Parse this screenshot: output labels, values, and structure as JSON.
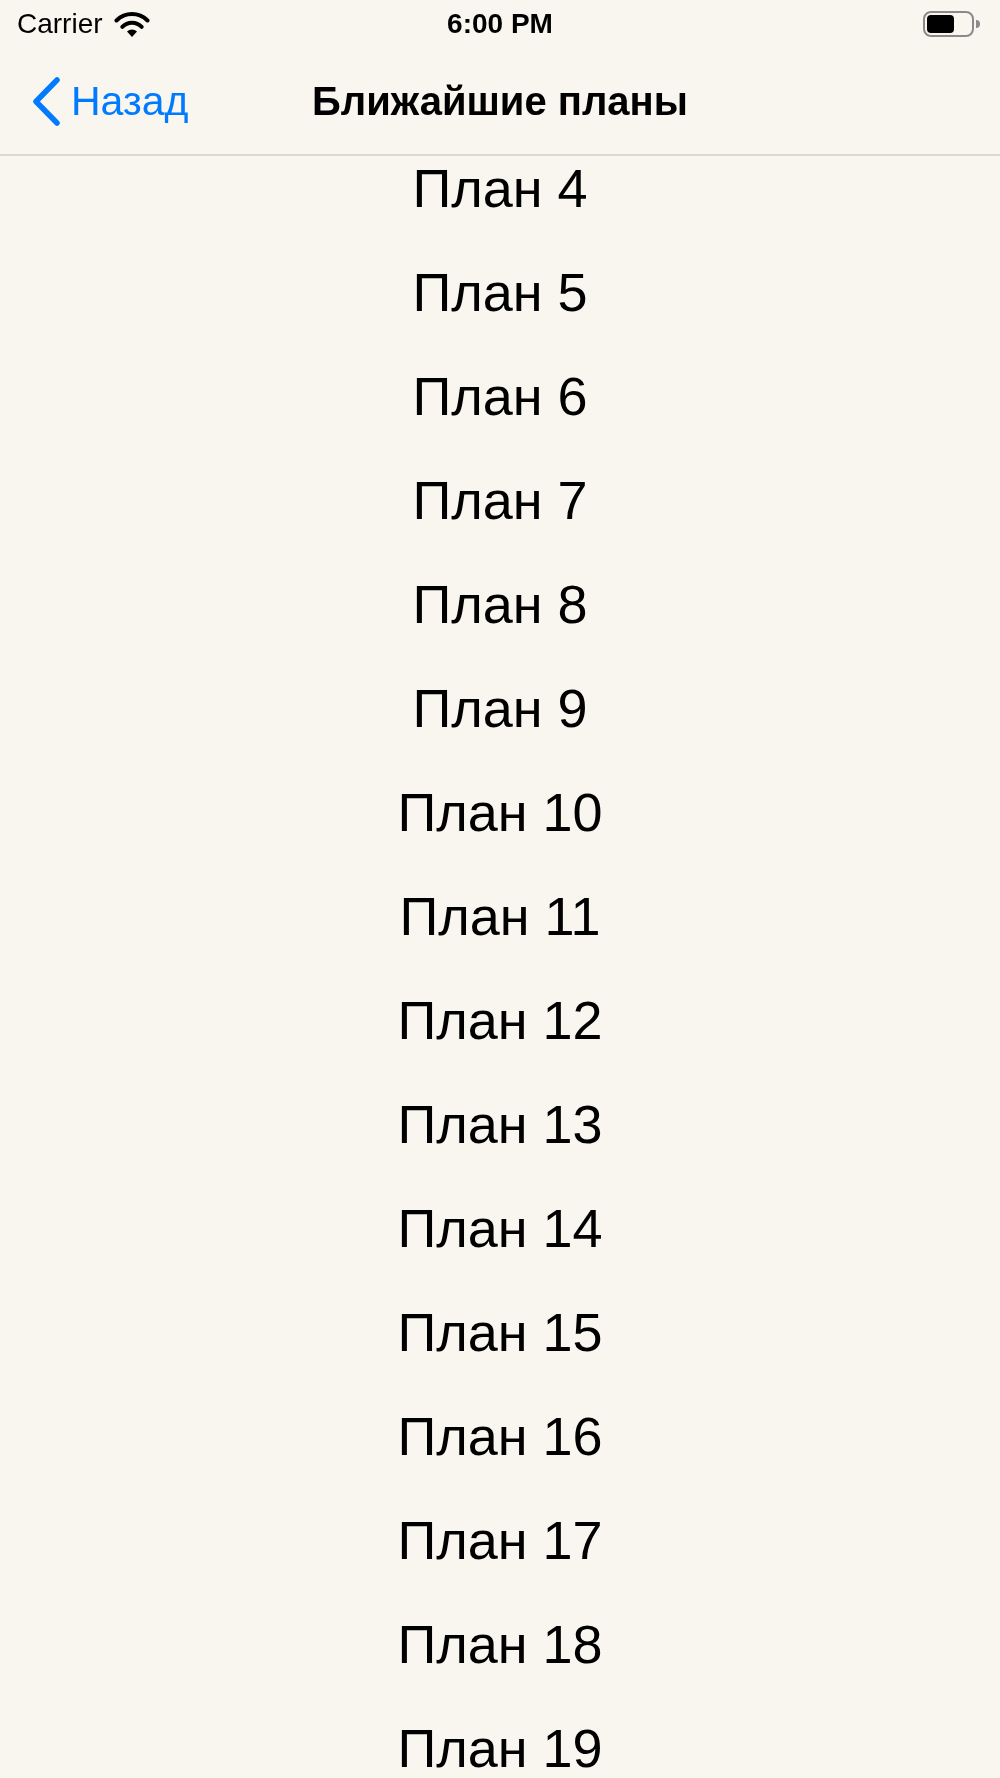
{
  "status_bar": {
    "carrier": "Carrier",
    "time": "6:00 PM"
  },
  "nav_bar": {
    "back_button": "Назад",
    "title": "Ближайшие планы"
  },
  "plans": [
    "План 4",
    "План 5",
    "План 6",
    "План 7",
    "План 8",
    "План 9",
    "План 10",
    "План 11",
    "План 12",
    "План 13",
    "План 14",
    "План 15",
    "План 16",
    "План 17",
    "План 18",
    "План 19"
  ]
}
